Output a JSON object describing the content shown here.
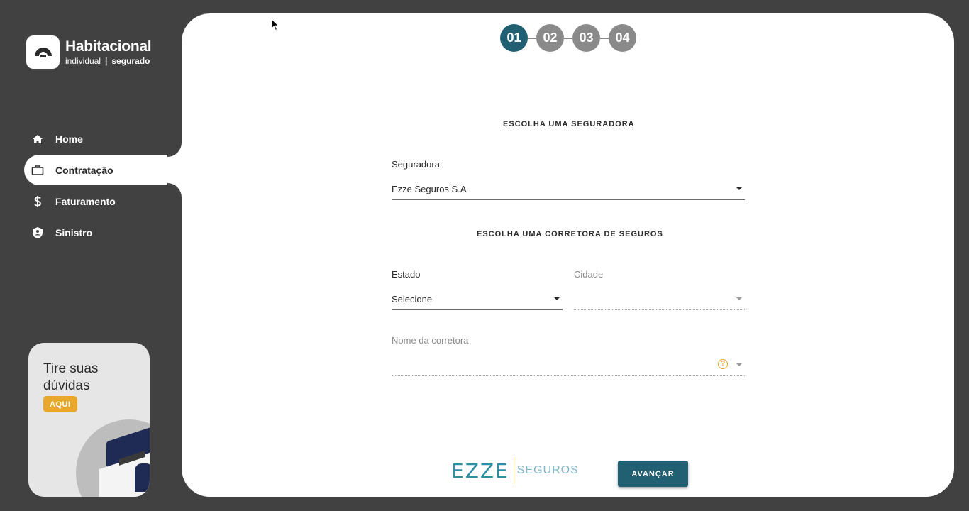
{
  "brand": {
    "title": "Habitacional",
    "sub_left": "individual",
    "sub_sep": "|",
    "sub_right": "segurado"
  },
  "nav": {
    "items": [
      {
        "label": "Home",
        "icon": "home-icon",
        "active": false
      },
      {
        "label": "Contratação",
        "icon": "briefcase-icon",
        "active": true
      },
      {
        "label": "Faturamento",
        "icon": "dollar-icon",
        "active": false
      },
      {
        "label": "Sinistro",
        "icon": "shield-icon",
        "active": false
      }
    ]
  },
  "help_card": {
    "title": "Tire suas dúvidas",
    "badge": "AQUI"
  },
  "steps": [
    "01",
    "02",
    "03",
    "04"
  ],
  "active_step": "01",
  "form": {
    "insurer_section_title": "ESCOLHA UMA SEGURADORA",
    "insurer_label": "Seguradora",
    "insurer_value": "Ezze Seguros S.A",
    "broker_section_title": "ESCOLHA UMA CORRETORA DE SEGUROS",
    "state_label": "Estado",
    "state_value": "Selecione",
    "city_label": "Cidade",
    "city_value": "",
    "broker_name_label": "Nome da corretora",
    "broker_name_value": ""
  },
  "footer": {
    "logo_main": "EZZE",
    "logo_sub": "SEGUROS",
    "next_button": "AVANÇAR"
  },
  "colors": {
    "sidebar_bg": "#414141",
    "primary": "#215f72",
    "accent": "#e8a82b",
    "step_inactive": "#8a8a8a"
  }
}
